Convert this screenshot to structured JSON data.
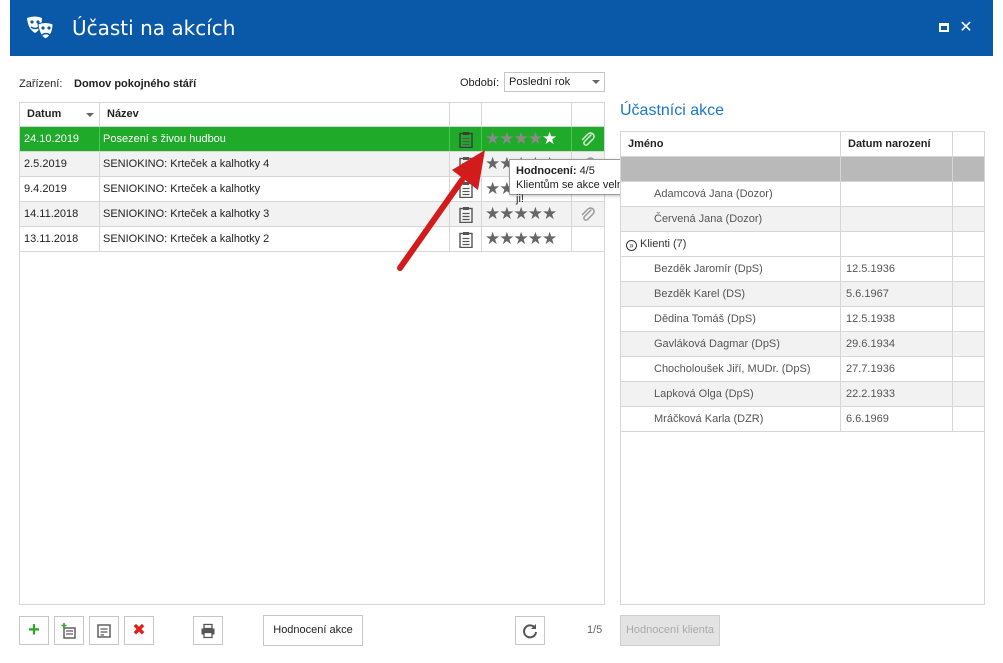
{
  "window": {
    "title": "Účasti na akcích"
  },
  "filters": {
    "facility_label": "Zařízení:",
    "facility_value": "Domov pokojného stáří",
    "period_label": "Období:",
    "period_value": "Poslední rok"
  },
  "events_grid": {
    "columns": [
      "Datum",
      "Název"
    ],
    "rows": [
      {
        "date": "24.10.2019",
        "name": "Posezení s živou hudbou",
        "rating": 4,
        "attachment": true,
        "selected": true
      },
      {
        "date": "2.5.2019",
        "name": "SENIOKINO: Krteček a kalhotky 4",
        "rating": 5,
        "attachment": true,
        "selected": false
      },
      {
        "date": "9.4.2019",
        "name": "SENIOKINO: Krteček a kalhotky",
        "rating": 5,
        "attachment": false,
        "selected": false
      },
      {
        "date": "14.11.2018",
        "name": "SENIOKINO: Krteček a kalhotky 3",
        "rating": 5,
        "attachment": true,
        "selected": false
      },
      {
        "date": "13.11.2018",
        "name": "SENIOKINO: Krteček a kalhotky 2",
        "rating": 5,
        "attachment": false,
        "selected": false
      }
    ]
  },
  "tooltip": {
    "rating_label": "Hodnocení:",
    "rating_value": "4/5",
    "text": "Klientům se akce velmi líbila, pochvalovali si ji!"
  },
  "participants": {
    "title": "Účastníci akce",
    "columns": [
      "Jméno",
      "Datum narození"
    ],
    "staff": [
      "Adamcová Jana (Dozor)",
      "Červená Jana (Dozor)"
    ],
    "clients_group": "Klienti (7)",
    "clients": [
      {
        "name": "Bezděk Jaromír (DpS)",
        "born": "12.5.1936"
      },
      {
        "name": "Bezděk Karel (DS)",
        "born": "5.6.1967"
      },
      {
        "name": "Dědina Tomáš (DpS)",
        "born": "12.5.1938"
      },
      {
        "name": "Gavláková Dagmar (DpS)",
        "born": "29.6.1934"
      },
      {
        "name": "Chocholoušek Jiří, MUDr. (DpS)",
        "born": "27.7.1936"
      },
      {
        "name": "Lapková Olga (DpS)",
        "born": "22.2.1933"
      },
      {
        "name": "Mráčková Karla (DZR)",
        "born": "6.6.1969"
      }
    ]
  },
  "toolbar": {
    "add_icon": "plus-icon",
    "rate_event_label": "Hodnocení akce",
    "pager": "1/5",
    "rate_client_label": "Hodnocení klienta"
  },
  "colors": {
    "titlebar": "#0a58a8",
    "selection": "#1faa2a",
    "accent": "#1b78c7",
    "annotation_arrow": "#d21c1c"
  }
}
